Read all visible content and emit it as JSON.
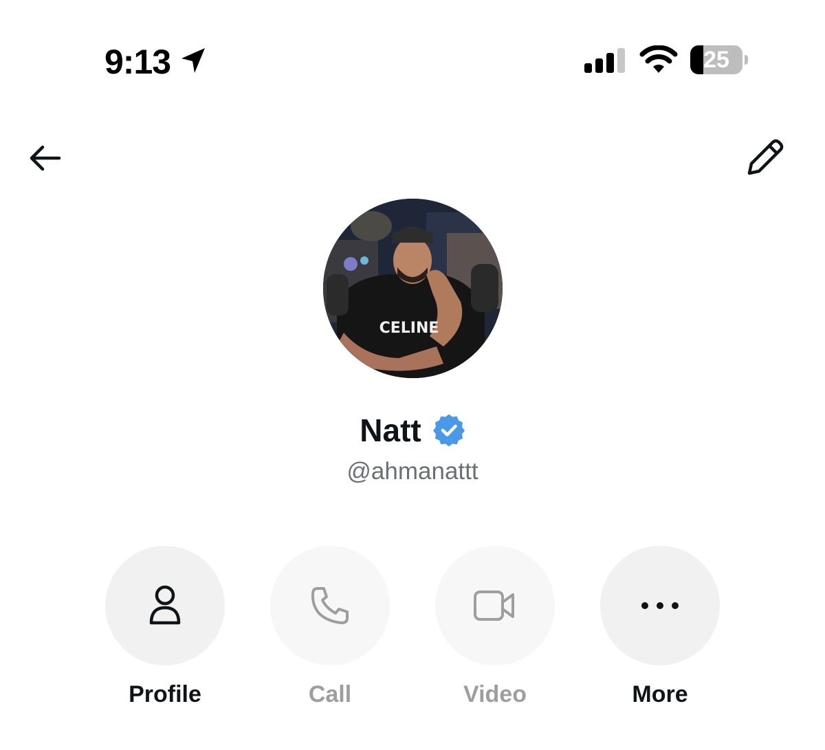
{
  "status_bar": {
    "time": "9:13",
    "battery_level": "25",
    "battery_fraction": 0.25,
    "icons": [
      "location-arrow-icon",
      "cellular-signal-icon",
      "wifi-icon",
      "battery-icon"
    ]
  },
  "header": {
    "back_icon": "arrow-left-icon",
    "edit_icon": "pencil-icon"
  },
  "profile": {
    "avatar_shirt_text": "CELINE",
    "name": "Natt",
    "handle": "@ahmanattt",
    "verified": true,
    "verified_color": "#4a99e9"
  },
  "actions": [
    {
      "label": "Profile",
      "icon": "person-icon",
      "enabled": true
    },
    {
      "label": "Call",
      "icon": "phone-icon",
      "enabled": false
    },
    {
      "label": "Video",
      "icon": "video-camera-icon",
      "enabled": false
    },
    {
      "label": "More",
      "icon": "more-dots-icon",
      "enabled": true
    }
  ],
  "colors": {
    "text_primary": "#0f1419",
    "text_secondary": "#6b6f73",
    "disabled": "#9e9e9e",
    "button_bg": "#f1f1f1",
    "button_bg_disabled": "#f7f7f7"
  }
}
